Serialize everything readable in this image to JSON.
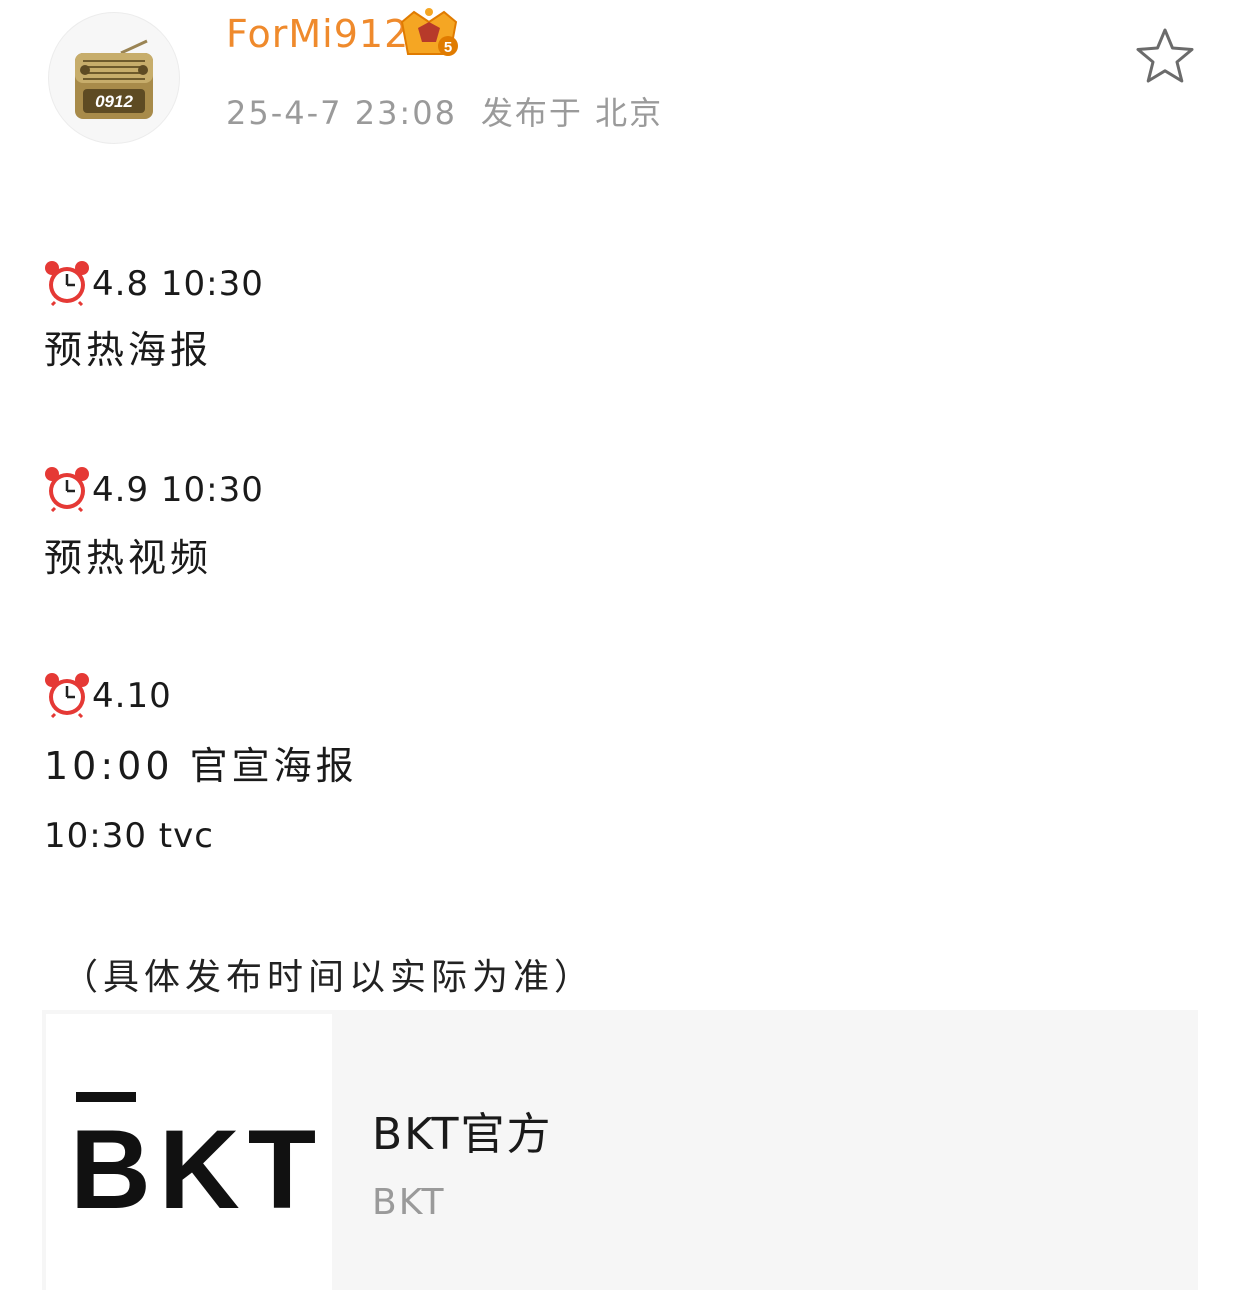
{
  "author": {
    "username": "ForMi912",
    "avatar_label": "0912",
    "badge_icon": "crown-level-badge-icon",
    "badge_level": "5",
    "timestamp": "25-4-7 23:08",
    "posted_from": "发布于 北京"
  },
  "actions": {
    "favorite_icon": "star-outline-icon"
  },
  "post": {
    "entries": [
      {
        "icon": "alarm-clock-icon",
        "datetime": "4.8 10:30",
        "desc": "预热海报"
      },
      {
        "icon": "alarm-clock-icon",
        "datetime": "4.9 10:30",
        "desc": "预热视频"
      },
      {
        "icon": "alarm-clock-icon",
        "datetime": "4.10",
        "line1": "10:00 官宣海报",
        "line2": "10:30 tvc"
      }
    ],
    "note": "（具体发布时间以实际为准）"
  },
  "link_card": {
    "thumb_logo_text": "BKT",
    "title": "BKT官方",
    "subtitle": "BKT"
  },
  "colors": {
    "username": "#ef8a2c",
    "meta": "#9a9a9a",
    "card_bg": "#f6f6f6",
    "alarm_red": "#e53935"
  }
}
